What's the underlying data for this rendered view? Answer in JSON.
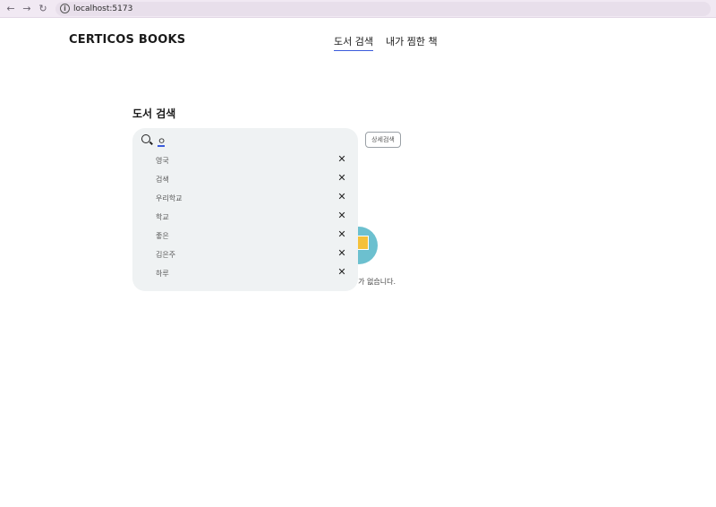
{
  "browser": {
    "back_glyph": "←",
    "forward_glyph": "→",
    "reload_glyph": "↻",
    "url": "localhost:5173"
  },
  "header": {
    "brand": "CERTICOS BOOKS",
    "tabs": [
      {
        "label": "도서 검색",
        "active": true
      },
      {
        "label": "내가 찜한 책",
        "active": false
      }
    ],
    "accent_color": "#3b5bdb"
  },
  "main": {
    "title": "도서 검색",
    "search": {
      "value": "ㅇ",
      "placeholder": ""
    },
    "detail_search_label": "상세검색",
    "history": [
      {
        "label": "영국"
      },
      {
        "label": "검색"
      },
      {
        "label": "우리학교"
      },
      {
        "label": "학교"
      },
      {
        "label": "좋은"
      },
      {
        "label": "김은주"
      },
      {
        "label": "하루"
      }
    ],
    "remove_glyph": "✕",
    "empty_state": {
      "text": "가 없습니다."
    }
  }
}
